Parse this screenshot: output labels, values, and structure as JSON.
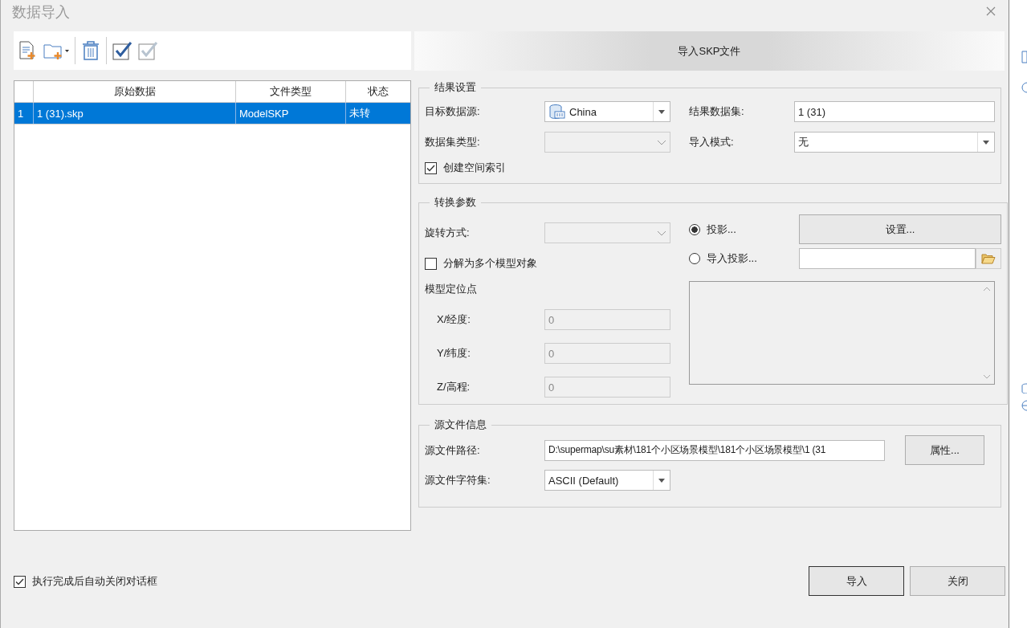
{
  "window": {
    "title": "数据导入"
  },
  "import_header": "导入SKP文件",
  "table": {
    "columns": [
      "原始数据",
      "文件类型",
      "状态"
    ],
    "rows": [
      {
        "index": "1",
        "cells": [
          "1 (31).skp",
          "ModelSKP",
          "未转"
        ],
        "selected": true
      }
    ]
  },
  "result_settings": {
    "title": "结果设置",
    "target_datasource": {
      "label": "目标数据源:",
      "value": "China"
    },
    "result_dataset": {
      "label": "结果数据集:",
      "value": "1 (31)"
    },
    "dataset_type": {
      "label": "数据集类型:",
      "disabled": true
    },
    "import_mode": {
      "label": "导入模式:",
      "value": "无"
    },
    "create_spatial_index": {
      "label": "创建空间索引",
      "checked": true
    }
  },
  "conversion": {
    "title": "转换参数",
    "rotation": {
      "label": "旋转方式:",
      "disabled": true
    },
    "split_models": {
      "label": "分解为多个模型对象",
      "checked": false
    },
    "anchor_title": "模型定位点",
    "anchor_fields": [
      {
        "label": "X/经度:",
        "value": "0",
        "disabled": true
      },
      {
        "label": "Y/纬度:",
        "value": "0",
        "disabled": true
      },
      {
        "label": "Z/高程:",
        "value": "0",
        "disabled": true
      }
    ],
    "projection_options": [
      {
        "label": "投影...",
        "selected": true
      },
      {
        "label": "导入投影...",
        "selected": false
      }
    ],
    "settings_button": "设置..."
  },
  "source_info": {
    "title": "源文件信息",
    "path": {
      "label": "源文件路径:",
      "value": "D:\\supermap\\su素材\\181个小区场景模型\\181个小区场景模型\\1 (31"
    },
    "properties_button": "属性...",
    "charset": {
      "label": "源文件字符集:",
      "value": "ASCII (Default)"
    }
  },
  "auto_close": {
    "label": "执行完成后自动关闭对话框",
    "checked": true
  },
  "buttons": [
    {
      "label": "导入",
      "kind": "primary"
    },
    {
      "label": "关闭",
      "kind": "normal"
    }
  ]
}
